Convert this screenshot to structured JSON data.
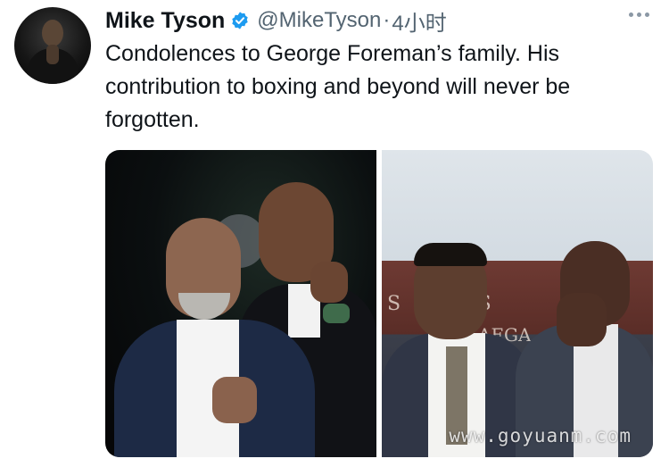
{
  "tweet": {
    "author_name": "Mike Tyson",
    "handle": "@MikeTyson",
    "separator": "·",
    "time_ago": "4小时",
    "text": "Condolences to George Foreman’s family. His contribution to boxing and beyond will never be forgotten.",
    "verified_icon": "verified-badge-icon",
    "more_icon": "more-options-icon"
  },
  "media": {
    "photo_count": 2,
    "right_photo_banner_text": "S   RS\nAEGA"
  },
  "watermark": "www.goyuanm.com",
  "colors": {
    "verified": "#1d9bf0",
    "text": "#0f1419",
    "secondary": "#536471"
  }
}
